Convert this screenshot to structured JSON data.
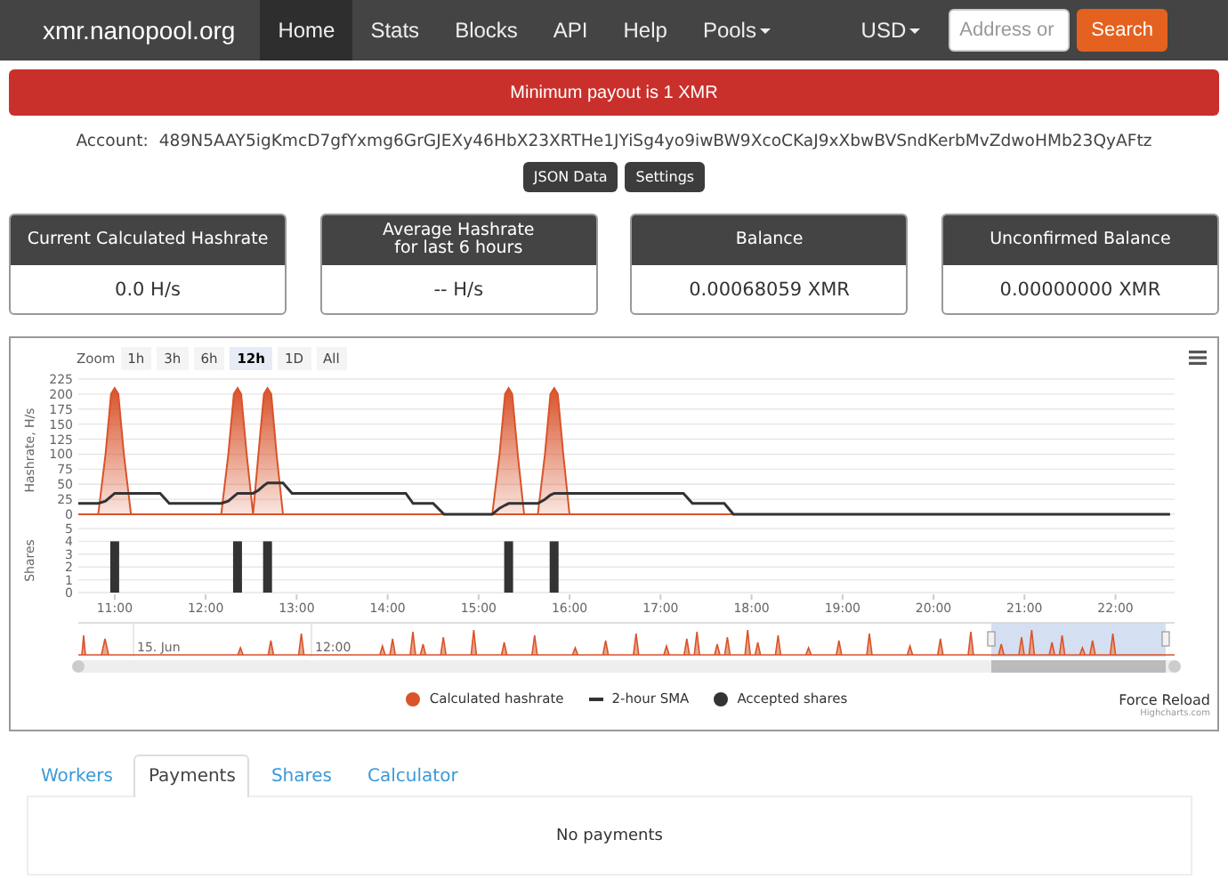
{
  "navbar": {
    "brand": "xmr.nanopool.org",
    "items": [
      {
        "label": "Home",
        "selected": true,
        "dropdown": false
      },
      {
        "label": "Stats",
        "selected": false,
        "dropdown": false
      },
      {
        "label": "Blocks",
        "selected": false,
        "dropdown": false
      },
      {
        "label": "API",
        "selected": false,
        "dropdown": false
      },
      {
        "label": "Help",
        "selected": false,
        "dropdown": false
      },
      {
        "label": "Pools",
        "selected": false,
        "dropdown": true
      }
    ],
    "currency": "USD",
    "search": {
      "placeholder": "Address or"
    },
    "search_button": "Search"
  },
  "alert": "Minimum payout is 1 XMR",
  "account": {
    "label": "Account:",
    "address": "489N5AAY5igKmcD7gfYxmg6GrGJEXy46HbX23XRTHe1JYiSg4yo9iwBW9XcoCKaJ9xXbwBVSndKerbMvZdwoHMb23QyAFtz"
  },
  "buttons": [
    "JSON Data",
    "Settings"
  ],
  "cards": [
    {
      "title": "Current Calculated Hashrate",
      "value": "0.0 H/s"
    },
    {
      "title": "Average Hashrate\nfor last 6 hours",
      "value": "-- H/s"
    },
    {
      "title": "Balance",
      "value": "0.00068059 XMR"
    },
    {
      "title": "Unconfirmed Balance",
      "value": "0.00000000 XMR"
    }
  ],
  "chart_panel": {
    "zoom_label": "Zoom",
    "ranges": [
      {
        "label": "1h",
        "selected": false
      },
      {
        "label": "3h",
        "selected": false
      },
      {
        "label": "6h",
        "selected": false
      },
      {
        "label": "12h",
        "selected": true
      },
      {
        "label": "1D",
        "selected": false
      },
      {
        "label": "All",
        "selected": false
      }
    ],
    "hashrate_chart": {
      "chart_data": {
        "type": "area",
        "ylabel": "Hashrate, H/s",
        "x": [
          10.6,
          10.82,
          10.9,
          10.96,
          11.0,
          11.04,
          11.1,
          11.18,
          11.5,
          11.6,
          12.17,
          12.25,
          12.31,
          12.35,
          12.39,
          12.45,
          12.52,
          12.58,
          12.64,
          12.68,
          12.72,
          12.78,
          12.85,
          12.95,
          14.2,
          14.28,
          14.5,
          14.62,
          15.15,
          15.23,
          15.29,
          15.33,
          15.37,
          15.43,
          15.5,
          15.65,
          15.73,
          15.79,
          15.83,
          15.87,
          15.93,
          16.0,
          17.25,
          17.35,
          17.7,
          17.8,
          22.6
        ],
        "series": [
          {
            "name": "Calculated hashrate",
            "color": "#d9532b",
            "values": [
              0,
              0,
              100,
              200,
              210,
              200,
              100,
              0,
              0,
              0,
              0,
              100,
              200,
              210,
              200,
              100,
              0,
              100,
              200,
              210,
              200,
              100,
              0,
              0,
              0,
              0,
              0,
              0,
              0,
              100,
              200,
              210,
              200,
              100,
              0,
              0,
              100,
              200,
              210,
              200,
              100,
              0,
              0,
              0,
              0,
              0,
              0
            ]
          },
          {
            "name": "2-hour SMA",
            "type": "line",
            "color": "#333333",
            "values": [
              18,
              18,
              22,
              30,
              35,
              35,
              35,
              35,
              35,
              18,
              18,
              22,
              30,
              35,
              35,
              35,
              35,
              40,
              48,
              52,
              52,
              52,
              52,
              35,
              35,
              18,
              18,
              0,
              0,
              10,
              15,
              18,
              18,
              18,
              18,
              18,
              25,
              32,
              35,
              35,
              35,
              35,
              35,
              18,
              18,
              0,
              0
            ]
          }
        ],
        "xlim": [
          10.6,
          22.65
        ],
        "ylim": [
          0,
          225
        ],
        "grid": true,
        "yticks": [
          0,
          25,
          50,
          75,
          100,
          125,
          150,
          175,
          200,
          225
        ]
      }
    },
    "shares_chart": {
      "chart_data": {
        "type": "bar",
        "ylabel": "Shares",
        "x": [
          11.0,
          12.35,
          12.68,
          15.33,
          15.83
        ],
        "series": [
          {
            "name": "Accepted shares",
            "color": "#333333",
            "values": [
              4,
              4,
              4,
              4,
              4
            ]
          }
        ],
        "xlim": [
          10.6,
          22.65
        ],
        "ylim": [
          0,
          5
        ],
        "grid": true,
        "yticks": [
          0,
          1,
          2,
          3,
          4,
          5
        ],
        "xticks": [
          {
            "value": 11,
            "label": "11:00"
          },
          {
            "value": 12,
            "label": "12:00"
          },
          {
            "value": 13,
            "label": "13:00"
          },
          {
            "value": 14,
            "label": "14:00"
          },
          {
            "value": 15,
            "label": "15:00"
          },
          {
            "value": 16,
            "label": "16:00"
          },
          {
            "value": 17,
            "label": "17:00"
          },
          {
            "value": 18,
            "label": "18:00"
          },
          {
            "value": 19,
            "label": "19:00"
          },
          {
            "value": 20,
            "label": "20:00"
          },
          {
            "value": 21,
            "label": "21:00"
          },
          {
            "value": 22,
            "label": "22:00"
          }
        ]
      }
    },
    "navigator": {
      "labels": [
        "15. Jun",
        "12:00"
      ]
    },
    "reload_link": "Force Reload",
    "credit": "Highcharts.com"
  },
  "tabs": [
    {
      "label": "Workers",
      "selected": false
    },
    {
      "label": "Payments",
      "selected": true
    },
    {
      "label": "Shares",
      "selected": false
    },
    {
      "label": "Calculator",
      "selected": false
    }
  ],
  "payments": {
    "message": "No payments"
  }
}
